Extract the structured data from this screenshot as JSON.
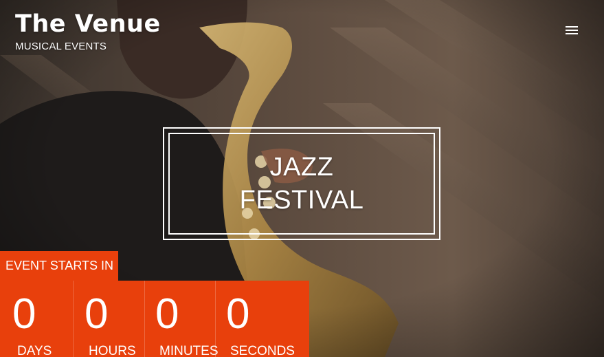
{
  "header": {
    "title": "The Venue",
    "subtitle": "MUSICAL EVENTS",
    "menu_icon": "hamburger-menu-icon"
  },
  "hero": {
    "title_line_1": "JAZZ",
    "title_line_2": "FESTIVAL",
    "background_image": "saxophone-player-photo"
  },
  "countdown": {
    "label": "EVENT STARTS IN",
    "accent_color": "#e8400c",
    "units": [
      {
        "value": "0",
        "caption": "DAYS"
      },
      {
        "value": "0",
        "caption": "HOURS"
      },
      {
        "value": "0",
        "caption": "MINUTES"
      },
      {
        "value": "0",
        "caption": "SECONDS"
      }
    ]
  }
}
